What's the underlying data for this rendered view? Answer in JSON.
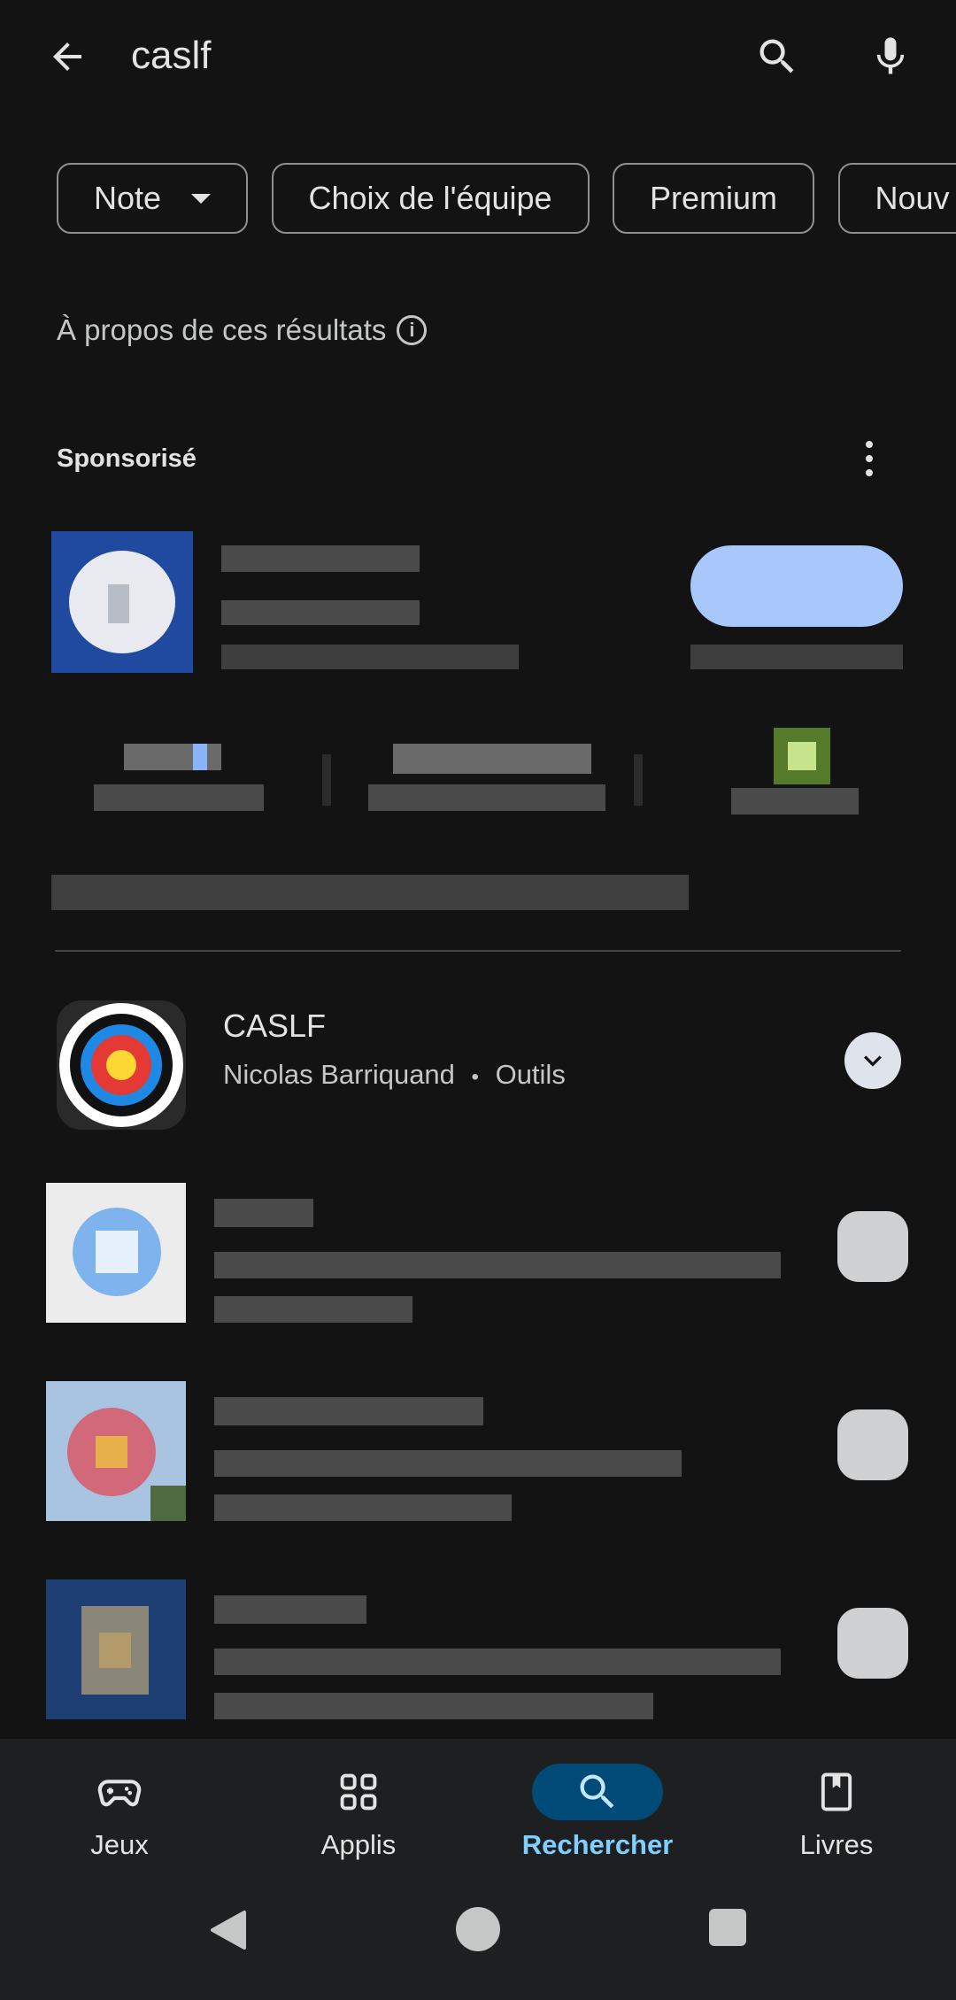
{
  "search": {
    "query": "caslf"
  },
  "icons": {
    "back": "arrow-back-icon",
    "search": "search-icon",
    "mic": "mic-icon"
  },
  "filters": [
    {
      "label": "Note",
      "has_dropdown": true
    },
    {
      "label": "Choix de l'équipe"
    },
    {
      "label": "Premium"
    },
    {
      "label": "Nouv"
    }
  ],
  "about_results": "À propos de ces résultats",
  "sponsored_label": "Sponsorisé",
  "result": {
    "title": "CASLF",
    "developer": "Nicolas Barriquand",
    "separator": "•",
    "category": "Outils"
  },
  "bottom_nav": [
    {
      "label": "Jeux",
      "icon": "gamepad-icon",
      "active": false
    },
    {
      "label": "Applis",
      "icon": "apps-grid-icon",
      "active": false
    },
    {
      "label": "Rechercher",
      "icon": "search-icon",
      "active": true
    },
    {
      "label": "Livres",
      "icon": "bookmark-book-icon",
      "active": false
    }
  ],
  "colors": {
    "background": "#131314",
    "active_nav_pill": "#004a77",
    "active_nav_text": "#7fcfff"
  }
}
